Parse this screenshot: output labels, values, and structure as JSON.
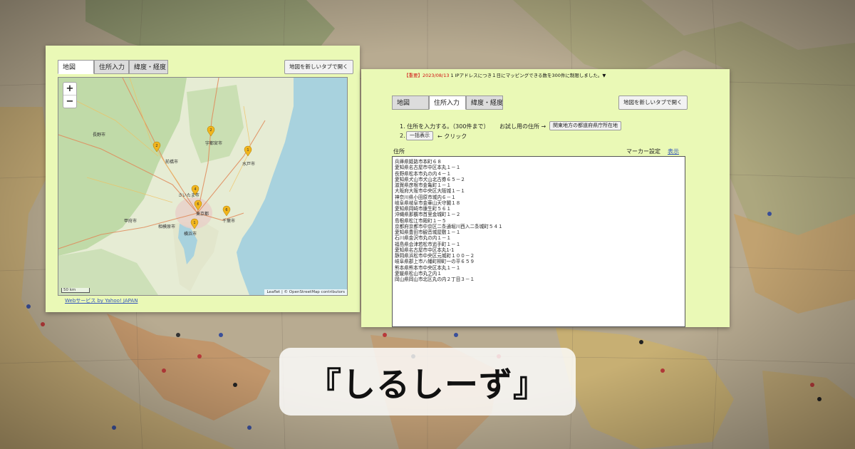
{
  "colors": {
    "panel_bg": "#eaf9b6",
    "link": "#3355bb",
    "notice_red": "#d01010"
  },
  "left_panel": {
    "tabs": [
      "地図",
      "住所入力",
      "緯度・経度"
    ],
    "open_new_tab": "地図を新しいタブで開く",
    "zoom_in": "+",
    "zoom_out": "−",
    "attribution": "Leaflet | © OpenStreetMap contributors",
    "scale": "50 km",
    "webservice_link": "Webサービス by Yahoo! JAPAN",
    "map_labels": [
      "長野市",
      "前橋市",
      "宇都宮市",
      "水戸市",
      "さいたま市",
      "東京都",
      "千葉市",
      "横浜市",
      "甲府市",
      "相模原市"
    ],
    "markers": [
      "2",
      "2",
      "1",
      "4",
      "6",
      "6",
      "1"
    ]
  },
  "right_panel": {
    "notice_prefix": "【重要】2023/08/13",
    "notice_text": "1 IPアドレスにつき１日にマッピングできる数を300件に制限しました。▼",
    "tabs": [
      "地図",
      "住所入力",
      "緯度・経度"
    ],
    "open_new_tab": "地図を新しいタブで開く",
    "step1": "1. 住所を入力する。（300件まで）",
    "sample_label": "お試し用の住所 →",
    "sample_button": "関東地方の都道府県庁所在地",
    "step2_num": "2.",
    "bulk_button": "一括表示",
    "click_hint": "← クリック",
    "address_label": "住所",
    "marker_settings": "マーカー設定",
    "show_link": "表示",
    "addresses": [
      "兵庫県姫路市本町６８",
      "愛知県名古屋市中区本丸１－１",
      "長野県松本市丸の内４－１",
      "愛知県犬山市犬山北古券６５－２",
      "滋賀県彦根市金亀町１－１",
      "大阪府大阪市中央区大阪城１－１",
      "神奈川県小田原市城内６－１",
      "岐阜県岐阜市金華山天守閣１８",
      "愛知県岡崎市康生町５６１",
      "沖縄県那覇市首里金城町１－２",
      "島根県松江市殿町１－５",
      "京都府京都市中京区二条通堀川西入二条城町５４１",
      "愛知県豊田市観音城屋敷１－１",
      "石川県金沢市丸の内１－１",
      "福島県会津若松市追手町１－１",
      "愛知県名古屋市中区本丸1-1",
      "静岡県浜松市中央区元城町１００－２",
      "岐阜県郡上市八幡町柳町一の平６５９",
      "熊本県熊本市中央区本丸１－１",
      "愛媛県松山市丸之内１",
      "岡山県岡山市北区丸の内２丁目３－１"
    ]
  },
  "title": "『しるしーず』"
}
